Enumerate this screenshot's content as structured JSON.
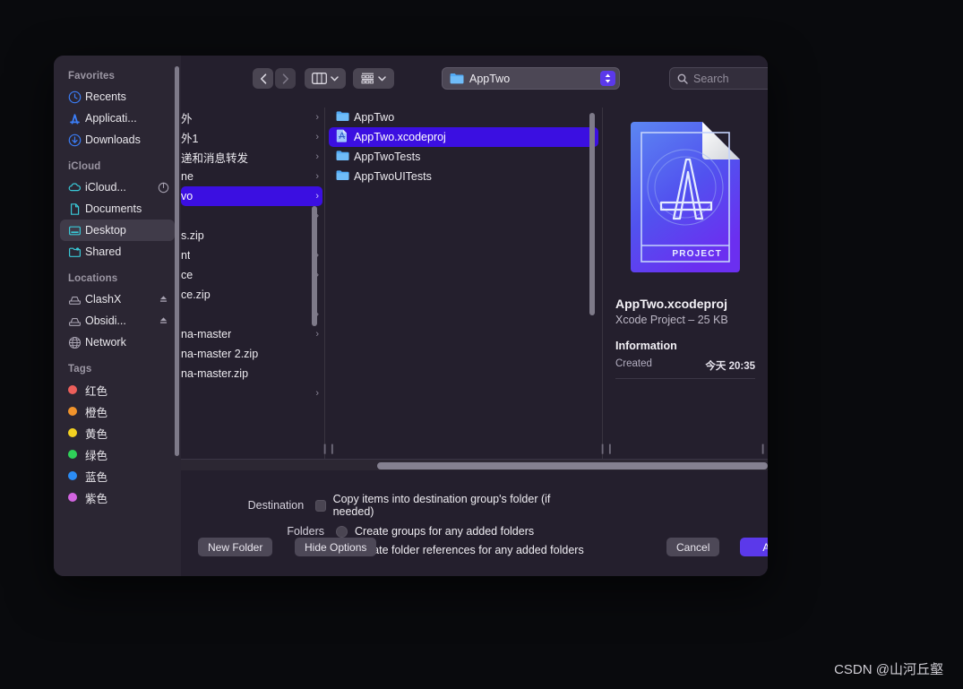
{
  "watermark": "CSDN @山河丘壑",
  "sidebar": {
    "sections": [
      {
        "header": "Favorites",
        "items": [
          {
            "label": "Recents",
            "icon": "clock-icon",
            "selected": false
          },
          {
            "label": "Applicati...",
            "icon": "appstore-icon",
            "selected": false
          },
          {
            "label": "Downloads",
            "icon": "download-circle-icon",
            "selected": false
          }
        ]
      },
      {
        "header": "iCloud",
        "items": [
          {
            "label": "iCloud...",
            "icon": "cloud-icon",
            "selected": false,
            "trailing": "progress-circle-icon"
          },
          {
            "label": "Documents",
            "icon": "document-icon",
            "selected": false
          },
          {
            "label": "Desktop",
            "icon": "desktop-icon",
            "selected": true
          },
          {
            "label": "Shared",
            "icon": "shared-folder-icon",
            "selected": false
          }
        ]
      },
      {
        "header": "Locations",
        "items": [
          {
            "label": "ClashX",
            "icon": "disk-icon",
            "selected": false,
            "trailing": "eject-icon"
          },
          {
            "label": "Obsidi...",
            "icon": "disk-icon",
            "selected": false,
            "trailing": "eject-icon"
          },
          {
            "label": "Network",
            "icon": "globe-icon",
            "selected": false
          }
        ]
      },
      {
        "header": "Tags",
        "items": [
          {
            "label": "红色",
            "icon": "tag-dot",
            "color": "#ec5f5b",
            "selected": false
          },
          {
            "label": "橙色",
            "icon": "tag-dot",
            "color": "#f0932b",
            "selected": false
          },
          {
            "label": "黄色",
            "icon": "tag-dot",
            "color": "#f3d121",
            "selected": false
          },
          {
            "label": "绿色",
            "icon": "tag-dot",
            "color": "#2fd159",
            "selected": false
          },
          {
            "label": "蓝色",
            "icon": "tag-dot",
            "color": "#2b8cf5",
            "selected": false
          },
          {
            "label": "紫色",
            "icon": "tag-dot",
            "color": "#d264e0",
            "selected": false
          }
        ]
      }
    ]
  },
  "toolbar": {
    "back_icon": "chevron-left-icon",
    "forward_icon": "chevron-right-icon",
    "view_mode_icon": "column-view-icon",
    "group_by_icon": "group-by-icon",
    "path_label": "AppTwo",
    "path_icon": "folder-icon",
    "search_placeholder": "Search",
    "search_value": "",
    "search_icon": "search-icon"
  },
  "browser": {
    "column1_items": [
      {
        "label": "外",
        "kind": "folder",
        "chevron": true,
        "selected": false
      },
      {
        "label": "外1",
        "kind": "folder",
        "chevron": true,
        "selected": false
      },
      {
        "label": "递和消息转发",
        "kind": "folder",
        "chevron": true,
        "selected": false
      },
      {
        "label": "ne",
        "kind": "folder",
        "chevron": true,
        "selected": false
      },
      {
        "label": "vo",
        "kind": "folder",
        "chevron": true,
        "selected": true
      },
      {
        "label": "",
        "kind": "folder",
        "chevron": true,
        "selected": false
      },
      {
        "label": "s.zip",
        "kind": "file",
        "chevron": false,
        "selected": false
      },
      {
        "label": "nt",
        "kind": "folder",
        "chevron": true,
        "selected": false
      },
      {
        "label": "ce",
        "kind": "folder",
        "chevron": true,
        "selected": false
      },
      {
        "label": "ce.zip",
        "kind": "file",
        "chevron": false,
        "selected": false
      },
      {
        "label": "",
        "kind": "folder",
        "chevron": true,
        "selected": false
      },
      {
        "label": "na-master",
        "kind": "folder",
        "chevron": true,
        "selected": false
      },
      {
        "label": "na-master 2.zip",
        "kind": "file",
        "chevron": false,
        "selected": false
      },
      {
        "label": "na-master.zip",
        "kind": "file",
        "chevron": false,
        "selected": false
      },
      {
        "label": "",
        "kind": "folder",
        "chevron": true,
        "selected": false
      }
    ],
    "column2_items": [
      {
        "label": "AppTwo",
        "kind": "folder",
        "chevron": true,
        "selected": false
      },
      {
        "label": "AppTwo.xcodeproj",
        "kind": "xcodeproj",
        "chevron": false,
        "selected": true
      },
      {
        "label": "AppTwoTests",
        "kind": "folder",
        "chevron": true,
        "selected": false
      },
      {
        "label": "AppTwoUITests",
        "kind": "folder",
        "chevron": true,
        "selected": false
      }
    ]
  },
  "preview": {
    "icon": "xcode-project-document-icon",
    "icon_badge": "PROJECT",
    "title": "AppTwo.xcodeproj",
    "subtitle": "Xcode Project – 25 KB",
    "info_heading": "Information",
    "rows": [
      {
        "label": "Created",
        "value": "今天 20:35"
      }
    ]
  },
  "options": {
    "destination_label": "Destination",
    "destination_checkbox_text": "Copy items into destination group's folder (if needed)",
    "destination_checked": false,
    "folders_label": "Folders",
    "folders_options": [
      {
        "text": "Create groups for any added folders",
        "selected": false
      },
      {
        "text": "Create folder references for any added folders",
        "selected": true
      }
    ]
  },
  "buttons": {
    "new_folder": "New Folder",
    "hide_options": "Hide Options",
    "cancel": "Cancel",
    "add": "Add"
  },
  "colors": {
    "selection": "#3b0fe1",
    "accent": "#5b39ea",
    "window_bg": "#241f2d",
    "sidebar_bg": "#2b2633"
  }
}
